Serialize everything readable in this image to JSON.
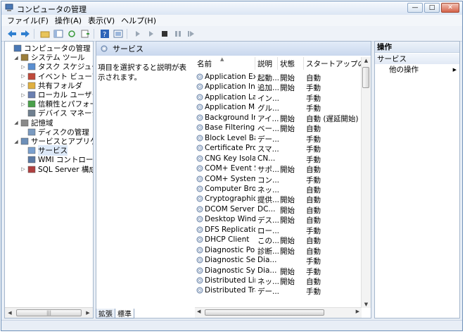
{
  "window": {
    "title": "コンピュータの管理"
  },
  "menu": [
    "ファイル(F)",
    "操作(A)",
    "表示(V)",
    "ヘルプ(H)"
  ],
  "tree": [
    {
      "label": "コンピュータの管理 (ローカル",
      "level": 0,
      "expander": "",
      "icon": "computer-management-icon"
    },
    {
      "label": "システム ツール",
      "level": 1,
      "expander": "◢",
      "icon": "system-tools-icon"
    },
    {
      "label": "タスク スケジューラ",
      "level": 2,
      "expander": "▷",
      "icon": "task-scheduler-icon"
    },
    {
      "label": "イベント ビューア",
      "level": 2,
      "expander": "▷",
      "icon": "event-viewer-icon"
    },
    {
      "label": "共有フォルダ",
      "level": 2,
      "expander": "▷",
      "icon": "shared-folder-icon"
    },
    {
      "label": "ローカル ユーザーとグ",
      "level": 2,
      "expander": "▷",
      "icon": "local-users-icon"
    },
    {
      "label": "信頼性とパフォーマン",
      "level": 2,
      "expander": "▷",
      "icon": "reliability-icon"
    },
    {
      "label": "デバイス マネージャ",
      "level": 2,
      "expander": "",
      "icon": "device-manager-icon"
    },
    {
      "label": "記憶域",
      "level": 1,
      "expander": "◢",
      "icon": "storage-icon"
    },
    {
      "label": "ディスクの管理",
      "level": 2,
      "expander": "",
      "icon": "disk-management-icon"
    },
    {
      "label": "サービスとアプリケーショ",
      "level": 1,
      "expander": "◢",
      "icon": "services-apps-icon"
    },
    {
      "label": "サービス",
      "level": 2,
      "expander": "",
      "icon": "services-icon",
      "selected": true
    },
    {
      "label": "WMI コントロール",
      "level": 2,
      "expander": "",
      "icon": "wmi-icon"
    },
    {
      "label": "SQL Server 構成マネ-",
      "level": 2,
      "expander": "▷",
      "icon": "sql-server-icon"
    }
  ],
  "center": {
    "header": "サービス",
    "description": "項目を選択すると説明が表示されます。",
    "columns": [
      "名前",
      "説明",
      "状態",
      "スタートアップの種類"
    ],
    "rows": [
      [
        "Application Exp...",
        "起動...",
        "開始",
        "自動"
      ],
      [
        "Application Info...",
        "追加...",
        "開始",
        "手動"
      ],
      [
        "Application Lay...",
        "イン...",
        "",
        "手動"
      ],
      [
        "Application Man...",
        "グル...",
        "",
        "手動"
      ],
      [
        "Background Int...",
        "アイ...",
        "開始",
        "自動 (遅延開始)"
      ],
      [
        "Base Filtering E...",
        "ベー...",
        "開始",
        "自動"
      ],
      [
        "Block Level Bac...",
        "デー...",
        "",
        "手動"
      ],
      [
        "Certificate Prop...",
        "スマ...",
        "",
        "手動"
      ],
      [
        "CNG Key Isolation",
        "CN...",
        "",
        "手動"
      ],
      [
        "COM+ Event Sy...",
        "サポ...",
        "開始",
        "自動"
      ],
      [
        "COM+ System ...",
        "コン...",
        "",
        "手動"
      ],
      [
        "Computer Brow...",
        "ネッ...",
        "",
        "自動"
      ],
      [
        "Cryptographic S...",
        "提供...",
        "開始",
        "自動"
      ],
      [
        "DCOM Server P...",
        "DC...",
        "開始",
        "自動"
      ],
      [
        "Desktop Windo...",
        "デス...",
        "開始",
        "自動"
      ],
      [
        "DFS Replication",
        "ロー...",
        "",
        "手動"
      ],
      [
        "DHCP Client",
        "この...",
        "開始",
        "自動"
      ],
      [
        "Diagnostic Polic...",
        "診断...",
        "開始",
        "自動"
      ],
      [
        "Diagnostic Servi...",
        "Dia...",
        "",
        "手動"
      ],
      [
        "Diagnostic Syst...",
        "Dia...",
        "開始",
        "手動"
      ],
      [
        "Distributed Link...",
        "ネッ...",
        "開始",
        "自動"
      ],
      [
        "Distributed Tran...",
        "デー...",
        "",
        "手動"
      ]
    ]
  },
  "tabs": [
    "拡張",
    "標準"
  ],
  "actions": {
    "header": "操作",
    "section": "サービス",
    "item": "他の操作"
  }
}
